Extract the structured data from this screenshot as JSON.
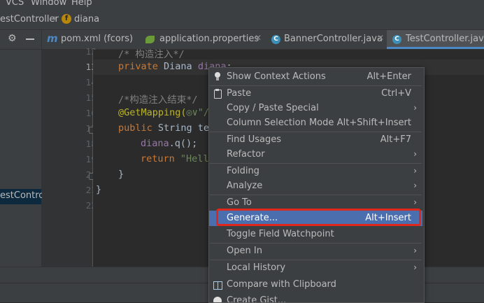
{
  "menubar": {
    "vcs": "VCS",
    "window": "Window",
    "help": "Help"
  },
  "breadcrumb": {
    "class_crumb": "estController",
    "member_crumb": "diana",
    "badge": "f"
  },
  "tabs": [
    {
      "label": "pom.xml (fcors)",
      "icon": "maven-icon",
      "active": false
    },
    {
      "label": "application.properties",
      "icon": "spring-leaf-icon",
      "active": false
    },
    {
      "label": "BannerController.java",
      "icon": "class-icon",
      "active": false
    },
    {
      "label": "TestController.java",
      "icon": "class-icon",
      "active": true
    }
  ],
  "project_panel": {
    "selected_item": "estController"
  },
  "gutter": {
    "lines": [
      "12",
      "13",
      "14",
      "15",
      "16",
      "17",
      "18",
      "19",
      "20",
      "21",
      "22"
    ],
    "current": "13"
  },
  "code": {
    "l12": "/* 构造注入*/",
    "l13_kw": "private",
    "l13_type": " Diana ",
    "l13_field": "diana",
    "l13_end": ";",
    "l15": "/*构造注入结束*/",
    "l16_ann": "@GetMapping(",
    "l16_str": "◎∨\"/",
    "l17_kw": "public",
    "l17_rest": " String tes",
    "l18_field": "diana",
    "l18_rest": ".q();",
    "l19_kw": "return",
    "l19_str": " \"Hello",
    "l20": "}",
    "l21": "}"
  },
  "context_menu": {
    "items": [
      {
        "label": "Show Context Actions",
        "shortcut": "Alt+Enter",
        "icon": "bulb-icon"
      },
      {
        "label": "Paste",
        "shortcut": "Ctrl+V",
        "icon": "paste-icon"
      },
      {
        "label": "Copy / Paste Special",
        "submenu": true
      },
      {
        "label": "Column Selection Mode",
        "shortcut": "Alt+Shift+Insert"
      },
      {
        "label": "Find Usages",
        "shortcut": "Alt+F7"
      },
      {
        "label": "Refactor",
        "submenu": true
      },
      {
        "label": "Folding",
        "submenu": true
      },
      {
        "label": "Analyze",
        "submenu": true
      },
      {
        "label": "Go To",
        "submenu": true
      },
      {
        "label": "Generate...",
        "shortcut": "Alt+Insert",
        "selected": true
      },
      {
        "label": "Toggle Field Watchpoint"
      },
      {
        "label": "Open In",
        "submenu": true
      },
      {
        "label": "Local History",
        "submenu": true
      },
      {
        "label": "Compare with Clipboard",
        "icon": "compare-icon"
      },
      {
        "label": "Create Gist...",
        "icon": "github-icon"
      }
    ]
  },
  "colors": {
    "selection": "#4b6eaf",
    "highlight_border": "#e0271c",
    "active_tab_underline": "#4a88c7"
  }
}
